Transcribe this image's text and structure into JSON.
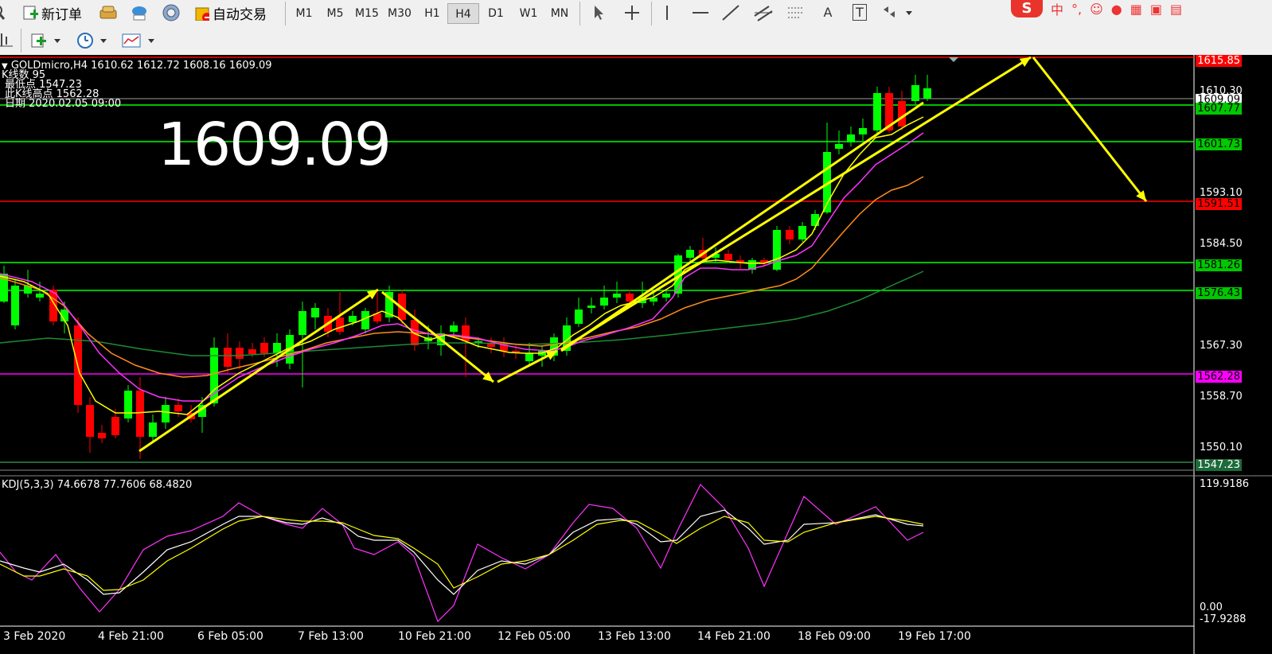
{
  "toolbar": {
    "new_order": "新订单",
    "auto_trade": "自动交易",
    "timeframes": [
      "M1",
      "M5",
      "M15",
      "M30",
      "H1",
      "H4",
      "D1",
      "W1",
      "MN"
    ],
    "active_timeframe": "H4",
    "tool_letter_a": "A",
    "tool_letter_t": "T"
  },
  "ime": {
    "logo": "S",
    "mode": "中",
    "punct": "°,"
  },
  "chart": {
    "header": "GOLDmicro,H4  1610.62 1612.72 1608.16 1609.09",
    "info_lines": [
      "K线数   95",
      "最低点 1547.23",
      "此K线高点 1562.28",
      "日期 2020.02.05 09:00"
    ],
    "big_price": "1609.09",
    "price_ticks": [
      "1610.30",
      "1593.10",
      "1584.50",
      "1567.30",
      "1558.70",
      "1550.10"
    ],
    "price_labels": [
      {
        "text": "1615.85",
        "bg": "#ff0000",
        "fg": "#ffffff"
      },
      {
        "text": "1609.09",
        "bg": "#ffffff",
        "fg": "#000000"
      },
      {
        "text": "1607.77",
        "bg": "#00c800",
        "fg": "#000000"
      },
      {
        "text": "1601.73",
        "bg": "#00c800",
        "fg": "#000000"
      },
      {
        "text": "1591.51",
        "bg": "#ff0000",
        "fg": "#000000"
      },
      {
        "text": "1581.26",
        "bg": "#00c800",
        "fg": "#000000"
      },
      {
        "text": "1576.43",
        "bg": "#00c800",
        "fg": "#000000"
      },
      {
        "text": "1562.28",
        "bg": "#ff00ff",
        "fg": "#000000"
      },
      {
        "text": "1547.23",
        "bg": "#1c6b3a",
        "fg": "#ffffff"
      }
    ],
    "kdj_label": "KDJ(5,3,3) 74.6678 77.7606 68.4820",
    "kdj_ticks": [
      "119.9186",
      "0.00",
      "-17.9288"
    ],
    "x_labels": [
      "3 Feb 2020",
      "4 Feb 21:00",
      "6 Feb 05:00",
      "7 Feb 13:00",
      "10 Feb 21:00",
      "12 Feb 05:00",
      "13 Feb 13:00",
      "14 Feb 21:00",
      "18 Feb 09:00",
      "19 Feb 17:00"
    ]
  },
  "colors": {
    "bull": "#00ff00",
    "bear": "#ff0000",
    "ma_fast": "#ffff00",
    "ma_mid": "#ff33ff",
    "ma_slow": "#ff8c1a",
    "ma_long": "#1e8c32",
    "arrow": "#ffff00"
  }
}
